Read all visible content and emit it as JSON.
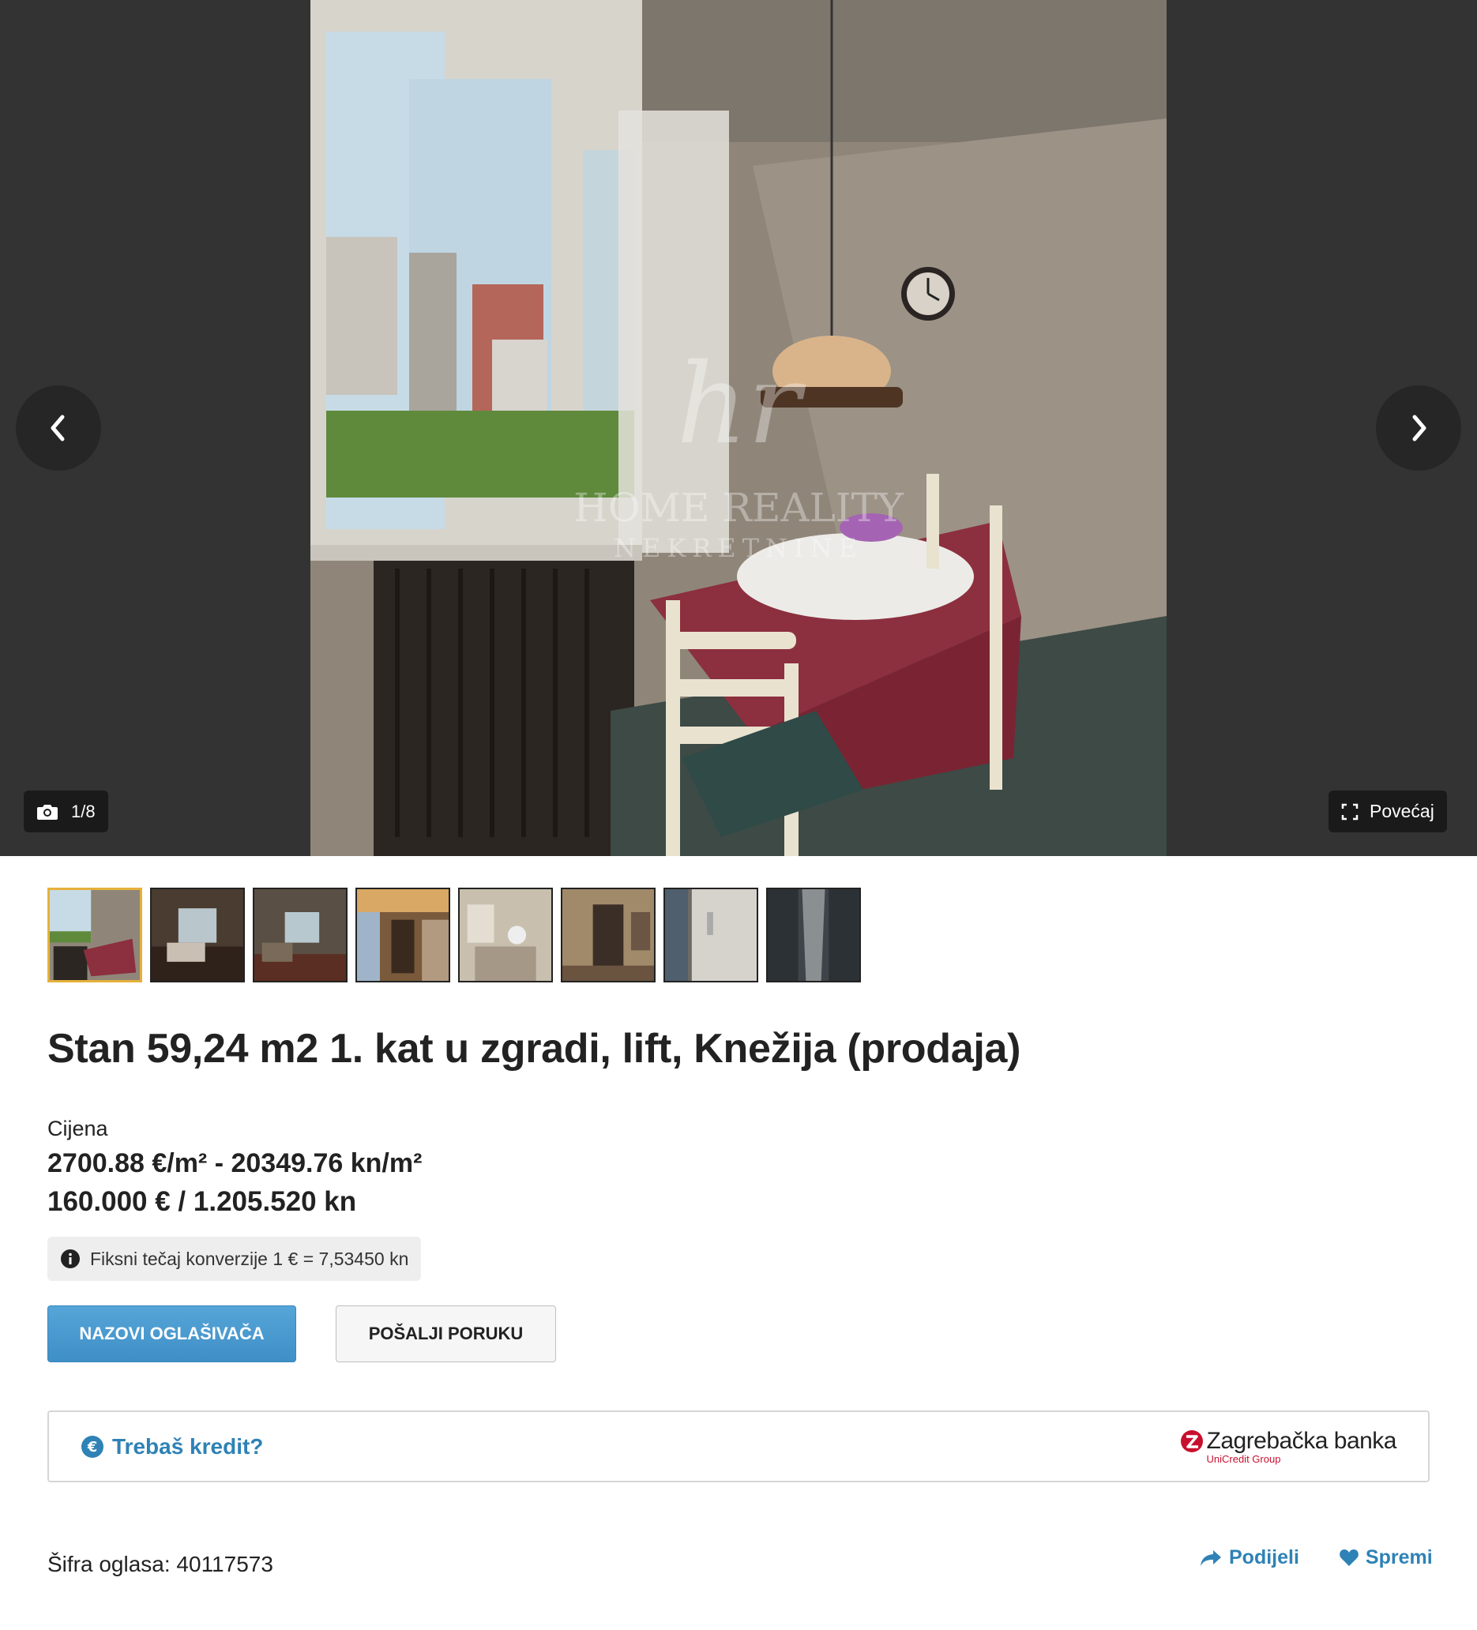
{
  "gallery": {
    "counter": "1/8",
    "enlarge_label": "Povećaj",
    "watermark_line1": "HOME REALITY",
    "watermark_line2": "NEKRETNINE",
    "thumbnail_count": 8,
    "active_index": 0
  },
  "listing": {
    "title": "Stan 59,24 m2 1. kat u zgradi, lift, Knežija (prodaja)",
    "price_label": "Cijena",
    "price_per_sqm": "2700.88 €/m² - 20349.76 kn/m²",
    "price_total": "160.000 € / 1.205.520 kn",
    "fx_note": "Fiksni tečaj konverzije 1 € = 7,53450 kn"
  },
  "buttons": {
    "call": "NAZOVI OGLAŠIVAČA",
    "message": "POŠALJI PORUKU"
  },
  "credit": {
    "link": "Trebaš kredit?",
    "bank_name": "Zagrebačka banka",
    "bank_sub": "UniCredit Group"
  },
  "footer": {
    "ad_code": "Šifra oglasa: 40117573",
    "share": "Podijeli",
    "save": "Spremi"
  },
  "colors": {
    "accent": "#2e82b5",
    "call_button": "#4a9bd1",
    "active_thumb_border": "#e5b13a",
    "gallery_bg": "#333333",
    "bank_red": "#c8102e"
  }
}
